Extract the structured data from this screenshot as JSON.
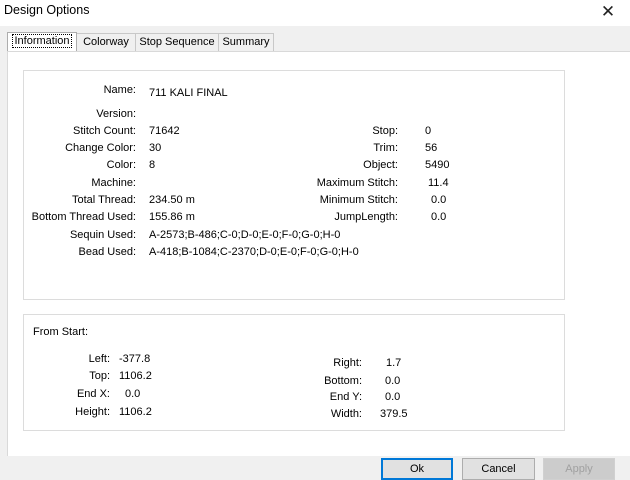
{
  "window": {
    "title": "Design Options",
    "close_glyph": "✕"
  },
  "tabs": [
    "Information",
    "Colorway",
    "Stop Sequence",
    "Summary"
  ],
  "info": {
    "name_label": "Name:",
    "name_value": "711 KALI FINAL",
    "version_label": "Version:",
    "version_value": "",
    "stitch_count_label": "Stitch Count:",
    "stitch_count_value": "71642",
    "change_color_label": "Change Color:",
    "change_color_value": "30",
    "color_label": "Color:",
    "color_value": "8",
    "machine_label": "Machine:",
    "machine_value": "",
    "total_thread_label": "Total Thread:",
    "total_thread_value": "234.50 m",
    "bottom_thread_label": "Bottom Thread Used:",
    "bottom_thread_value": "155.86 m",
    "sequin_label": "Sequin Used:",
    "sequin_value": "A-2573;B-486;C-0;D-0;E-0;F-0;G-0;H-0",
    "bead_label": "Bead Used:",
    "bead_value": "A-418;B-1084;C-2370;D-0;E-0;F-0;G-0;H-0",
    "stop_label": "Stop:",
    "stop_value": "0",
    "trim_label": "Trim:",
    "trim_value": "56",
    "object_label": "Object:",
    "object_value": "5490",
    "max_stitch_label": "Maximum Stitch:",
    "max_stitch_value": "11.4",
    "min_stitch_label": "Minimum Stitch:",
    "min_stitch_value": "0.0",
    "jump_length_label": "JumpLength:",
    "jump_length_value": "0.0"
  },
  "from_start": {
    "title": "From Start:",
    "left_label": "Left:",
    "left_value": "-377.8",
    "top_label": "Top:",
    "top_value": "1106.2",
    "endx_label": "End X:",
    "endx_value": "0.0",
    "height_label": "Height:",
    "height_value": "1106.2",
    "right_label": "Right:",
    "right_value": "1.7",
    "bottom_label": "Bottom:",
    "bottom_value": "0.0",
    "endy_label": "End Y:",
    "endy_value": "0.0",
    "width_label": "Width:",
    "width_value": "379.5"
  },
  "buttons": {
    "ok": "Ok",
    "cancel": "Cancel",
    "apply": "Apply"
  }
}
